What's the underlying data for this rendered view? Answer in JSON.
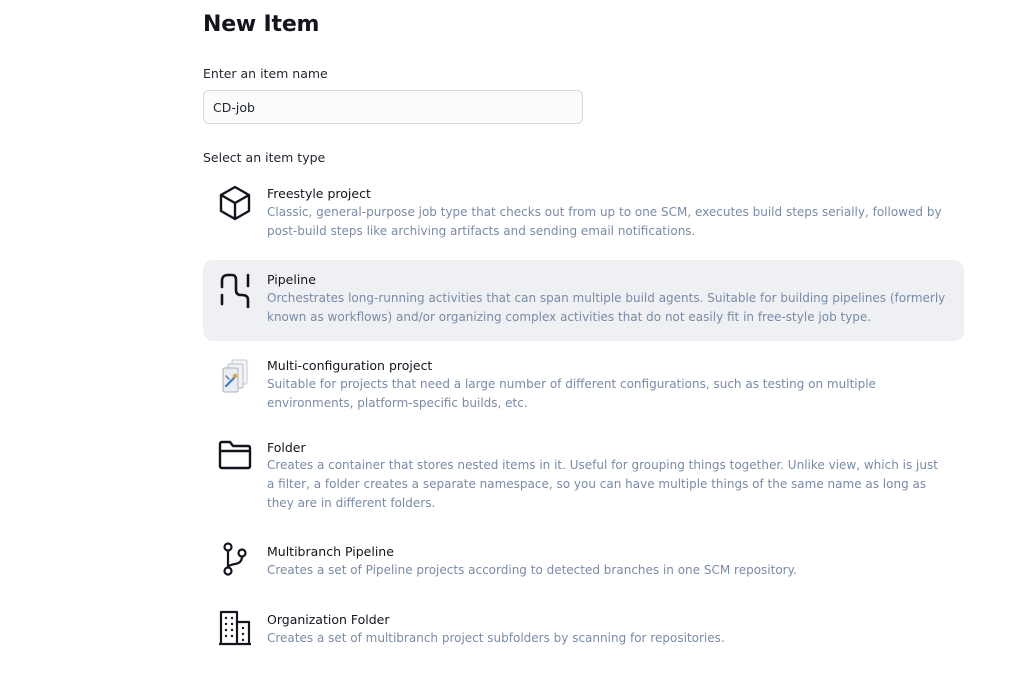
{
  "page": {
    "title": "New Item",
    "name_label": "Enter an item name",
    "name_value": "CD-job",
    "type_label": "Select an item type"
  },
  "items": [
    {
      "name": "Freestyle project",
      "description": "Classic, general-purpose job type that checks out from up to one SCM, executes build steps serially, followed by post-build steps like archiving artifacts and sending email notifications.",
      "icon": "cube-icon",
      "selected": false
    },
    {
      "name": "Pipeline",
      "description": "Orchestrates long-running activities that can span multiple build agents. Suitable for building pipelines (formerly known as workflows) and/or organizing complex activities that do not easily fit in free-style job type.",
      "icon": "pipeline-icon",
      "selected": true
    },
    {
      "name": "Multi-configuration project",
      "description": "Suitable for projects that need a large number of different configurations, such as testing on multiple environments, platform-specific builds, etc.",
      "icon": "stacked-documents-icon",
      "selected": false
    },
    {
      "name": "Folder",
      "description": "Creates a container that stores nested items in it. Useful for grouping things together. Unlike view, which is just a filter, a folder creates a separate namespace, so you can have multiple things of the same name as long as they are in different folders.",
      "icon": "folder-icon",
      "selected": false
    },
    {
      "name": "Multibranch Pipeline",
      "description": "Creates a set of Pipeline projects according to detected branches in one SCM repository.",
      "icon": "branch-icon",
      "selected": false
    },
    {
      "name": "Organization Folder",
      "description": "Creates a set of multibranch project subfolders by scanning for repositories.",
      "icon": "building-icon",
      "selected": false
    }
  ],
  "colors": {
    "selected_background": "#eef0f4",
    "description_text": "#7a8ba6",
    "title_text": "#14141f"
  }
}
